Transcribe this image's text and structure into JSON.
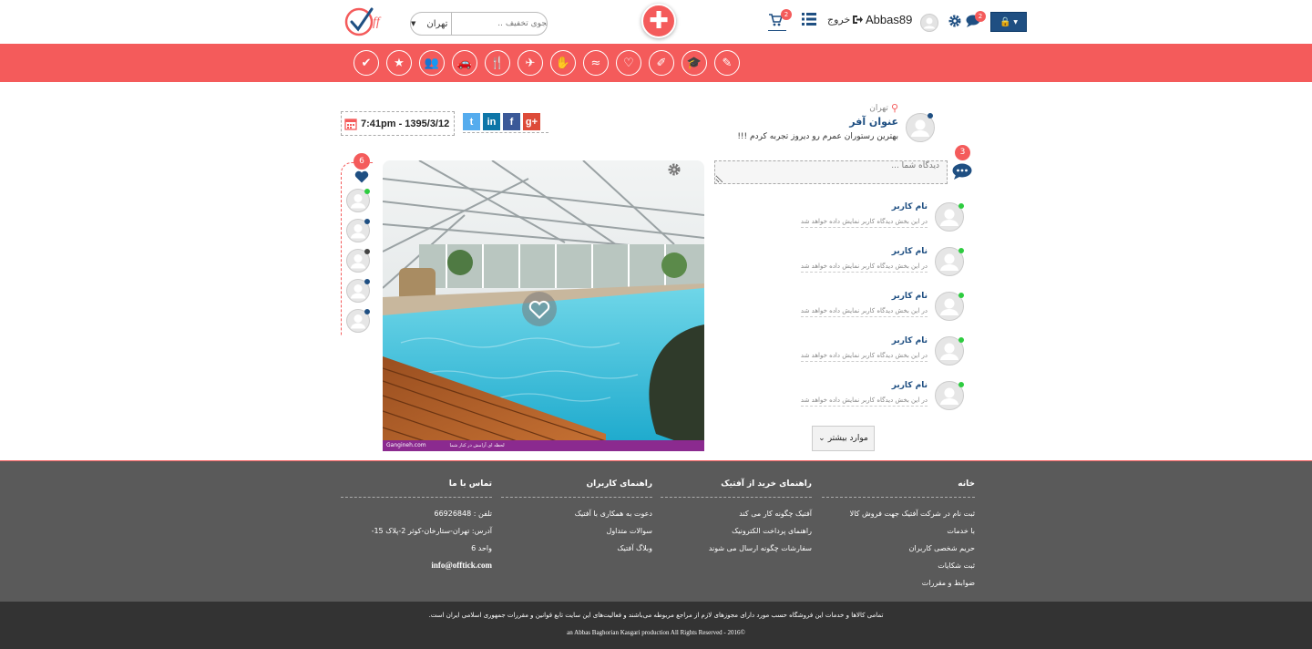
{
  "header": {
    "search_city": "تهران",
    "search_placeholder": "جستجوی تخفیف ..",
    "cart_count": "2",
    "logout_label": "خروج",
    "username": "Abbas89",
    "messages_count": "2"
  },
  "categories": [
    {
      "icon": "beauty-icon"
    },
    {
      "icon": "education-icon"
    },
    {
      "icon": "art-icon"
    },
    {
      "icon": "health-icon"
    },
    {
      "icon": "swimming-icon"
    },
    {
      "icon": "massage-icon"
    },
    {
      "icon": "travel-icon"
    },
    {
      "icon": "restaurant-icon"
    },
    {
      "icon": "car-icon"
    },
    {
      "icon": "people-icon"
    },
    {
      "icon": "favorite-icon"
    },
    {
      "icon": "discount-icon"
    }
  ],
  "post": {
    "location": "تهران",
    "title": "عنوان آفر",
    "description": "بهترین رستوران عمرم رو دیروز تجربه کردم !!!",
    "datetime": "7:41pm - 1395/3/12",
    "likes_count": "6",
    "comments_count": "3",
    "image_caption": "Gangineh.com",
    "image_caption_small": "لحظه ای آرامش در کنار شما"
  },
  "share_buttons": [
    {
      "label": "t",
      "network": "twitter",
      "color": "#55acee"
    },
    {
      "label": "in",
      "network": "linkedin",
      "color": "#0e76a8"
    },
    {
      "label": "f",
      "network": "facebook",
      "color": "#3b5998"
    },
    {
      "label": "g+",
      "network": "google-plus",
      "color": "#dd4b39"
    }
  ],
  "likers": [
    {
      "status": "#2ecc40"
    },
    {
      "status": "#1f4f82"
    },
    {
      "status": "#444444"
    },
    {
      "status": "#1f4f82"
    },
    {
      "status": "#1f4f82"
    }
  ],
  "comments": {
    "input_placeholder": "دیدگاه شما ...",
    "items": [
      {
        "name": "نام کاربر",
        "text": "در این بخش دیدگاه کاربر نمایش داده خواهد شد"
      },
      {
        "name": "نام کاربر",
        "text": "در این بخش دیدگاه کاربر نمایش داده خواهد شد"
      },
      {
        "name": "نام کاربر",
        "text": "در این بخش دیدگاه کاربر نمایش داده خواهد شد"
      },
      {
        "name": "نام کاربر",
        "text": "در این بخش دیدگاه کاربر نمایش داده خواهد شد"
      },
      {
        "name": "نام کاربر",
        "text": "در این بخش دیدگاه کاربر نمایش داده خواهد شد"
      }
    ],
    "more_label": "موارد بیشتر"
  },
  "footer": {
    "col1": {
      "title": "خانه",
      "items": [
        "ثبت نام در شرکت آفتیک جهت فروش کالا",
        "با خدمات",
        "حریم شخصی کاربران",
        "ثبت شکایات",
        "ضوابط و مقررات"
      ]
    },
    "col2": {
      "title": "راهنمای خرید از آفتیک",
      "items": [
        "آفتیک چگونه کار می کند",
        "راهنمای پرداخت الکترونیک",
        "سفارشات چگونه ارسال می شوند"
      ]
    },
    "col3": {
      "title": "راهنمای کاربران",
      "items": [
        "دعوت به همکاری با آفتیک",
        "سوالات متداول",
        "وبلاگ آفتیک"
      ]
    },
    "col4": {
      "title": "تماس با ما",
      "items": [
        "تلفن : 66926848",
        "آدرس: تهران-ستارخان-کوثر 2-پلاک 15-",
        "واحد 6",
        "info@offtick.com"
      ]
    },
    "legal": "تمامی کالاها و خدمات این فروشگاه حسب مورد دارای مجوزهای لازم از مراجع مربوطه می‌باشند و فعالیت‌های این سایت تابع قوانین و مقررات جمهوری اسلامی ایران است.",
    "copyright": "an Abbas Baghorian Kasgari production All Rights Reserved - 2016©"
  },
  "colors": {
    "brand": "#f45b5b",
    "accent": "#1f4f82",
    "footer": "#5a5a5a"
  }
}
